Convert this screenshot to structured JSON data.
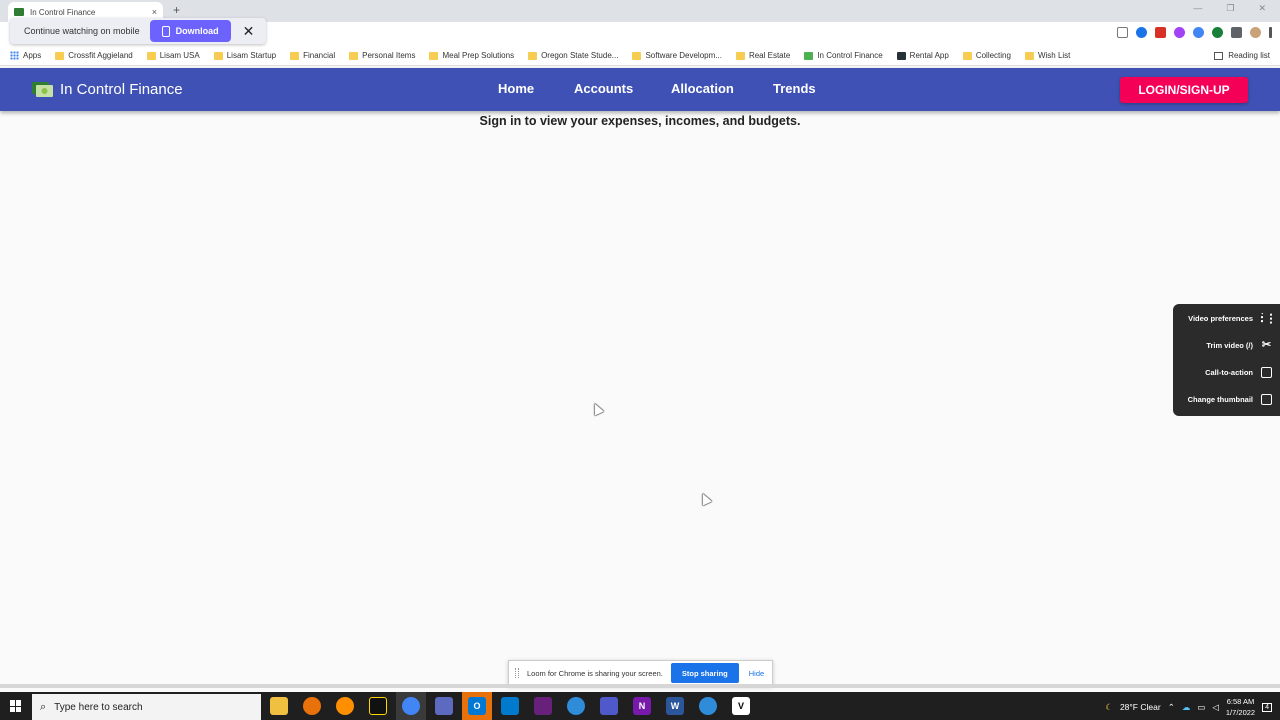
{
  "browser": {
    "tab_title": "In Control Finance",
    "tab_close": "×",
    "new_tab": "+",
    "window_controls": [
      "—",
      "❐",
      "✕"
    ],
    "bookmarks": [
      {
        "label": "Apps",
        "icon": "apps-grid-icon"
      },
      {
        "label": "Crossfit Aggieland",
        "icon": "folder-icon"
      },
      {
        "label": "Lisam USA",
        "icon": "folder-icon"
      },
      {
        "label": "Lisam Startup",
        "icon": "folder-icon"
      },
      {
        "label": "Financial",
        "icon": "folder-icon"
      },
      {
        "label": "Personal Items",
        "icon": "folder-icon"
      },
      {
        "label": "Meal Prep Solutions",
        "icon": "folder-icon"
      },
      {
        "label": "Oregon State Stude...",
        "icon": "folder-icon"
      },
      {
        "label": "Software Developm...",
        "icon": "folder-icon"
      },
      {
        "label": "Real Estate",
        "icon": "folder-icon"
      },
      {
        "label": "In Control Finance",
        "icon": "money-icon"
      },
      {
        "label": "Rental App",
        "icon": "app-icon"
      },
      {
        "label": "Collecting",
        "icon": "folder-icon"
      },
      {
        "label": "Wish List",
        "icon": "folder-icon"
      }
    ],
    "reading_list": "Reading list"
  },
  "continue_popup": {
    "text": "Continue watching on mobile",
    "download_label": "Download",
    "close": "✕"
  },
  "app": {
    "brand": "In Control Finance",
    "nav": [
      "Home",
      "Accounts",
      "Allocation",
      "Trends"
    ],
    "login_label": "LOGIN/SIGN-UP",
    "message": "Sign in to view your expenses, incomes, and budgets.",
    "colors": {
      "appbar": "#3f51b5",
      "login": "#f50057"
    }
  },
  "loom_panel": {
    "items": [
      {
        "label": "Video preferences",
        "icon": "sliders-icon"
      },
      {
        "label": "Trim video (/)",
        "icon": "scissors-icon"
      },
      {
        "label": "Call-to-action",
        "icon": "cursor-click-icon"
      },
      {
        "label": "Change thumbnail",
        "icon": "image-icon"
      }
    ]
  },
  "share_bar": {
    "text": "Loom for Chrome is sharing your screen.",
    "stop_label": "Stop sharing",
    "hide_label": "Hide"
  },
  "taskbar": {
    "search_placeholder": "Type here to search",
    "weather": "28°F  Clear",
    "time": "6:58 AM",
    "date": "1/7/2022",
    "notification_count": "4"
  }
}
